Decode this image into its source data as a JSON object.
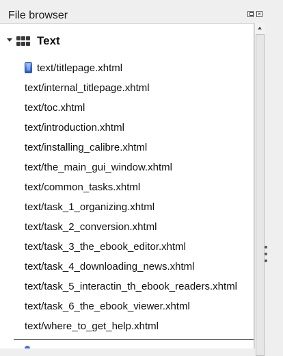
{
  "dock": {
    "title": "File browser",
    "float_button": "float",
    "close_button": "×"
  },
  "tree": {
    "group": {
      "label": "Text",
      "expanded": true
    },
    "files": [
      {
        "name": "text/titlepage.xhtml",
        "icon": "page-icon"
      },
      {
        "name": "text/internal_titlepage.xhtml"
      },
      {
        "name": "text/toc.xhtml"
      },
      {
        "name": "text/introduction.xhtml"
      },
      {
        "name": "text/installing_calibre.xhtml"
      },
      {
        "name": "text/the_main_gui_window.xhtml"
      },
      {
        "name": "text/common_tasks.xhtml"
      },
      {
        "name": "text/task_1_organizing.xhtml"
      },
      {
        "name": "text/task_2_conversion.xhtml"
      },
      {
        "name": "text/task_3_the_ebook_editor.xhtml"
      },
      {
        "name": "text/task_4_downloading_news.xhtml"
      },
      {
        "name": "text/task_5_interactin_th_ebook_readers.xhtml"
      },
      {
        "name": "text/task_6_the_ebook_viewer.xhtml"
      },
      {
        "name": "text/where_to_get_help.xhtml"
      }
    ]
  },
  "colors": {
    "icon_blue": "#3c74e0",
    "panel_bg": "#efefef",
    "list_bg": "#ffffff"
  }
}
